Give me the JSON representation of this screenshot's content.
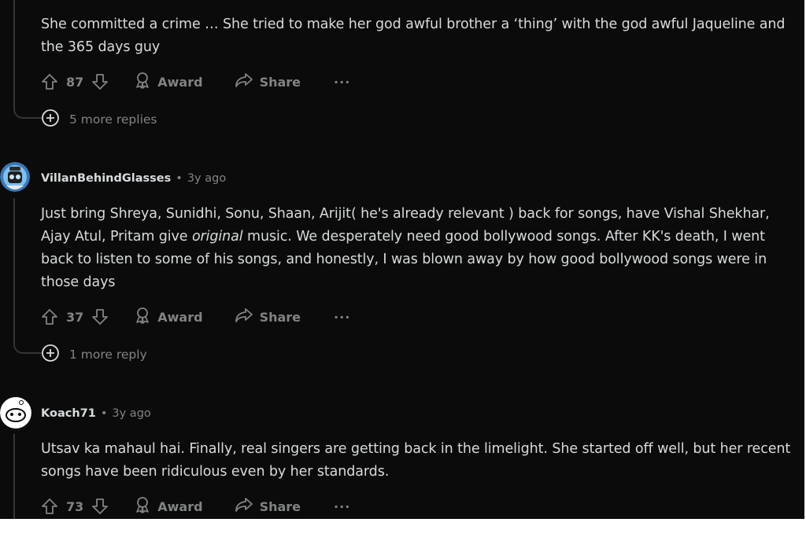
{
  "comments": [
    {
      "body": "She committed a crime … She tried to make her god awful brother a ‘thing’ with the god awful Jaqueline and the 365 days guy",
      "votes": "87",
      "award_label": "Award",
      "share_label": "Share",
      "more_label": "···",
      "more_replies": "5 more replies"
    },
    {
      "author": "VillanBehindGlasses",
      "separator": "•",
      "age": "3y ago",
      "body_before": "Just bring Shreya, Sunidhi, Sonu, Shaan, Arijit( he's already relevant ) back for songs, have Vishal Shekhar, Ajay Atul, Pritam give ",
      "body_italic": "original",
      "body_after": " music. We desperately need good bollywood songs. After KK's death, I went back to listen to some of his songs, and honestly, I was blown away by how good bollywood songs were in those days",
      "votes": "37",
      "award_label": "Award",
      "share_label": "Share",
      "more_label": "···",
      "more_replies": "1 more reply"
    },
    {
      "author": "Koach71",
      "separator": "•",
      "age": "3y ago",
      "body": "Utsav ka mahaul hai. Finally, real singers are getting back in the limelight. She started off well, but her recent songs have been ridiculous even by her standards.",
      "votes": "73",
      "award_label": "Award",
      "share_label": "Share",
      "more_label": "···"
    }
  ],
  "colors": {
    "background": "#0b0b0b",
    "text": "#d7dadc",
    "muted": "#818384",
    "thread_line": "#343536"
  },
  "icons": [
    "upvote-icon",
    "downvote-icon",
    "award-icon",
    "share-icon",
    "expand-plus-icon"
  ]
}
